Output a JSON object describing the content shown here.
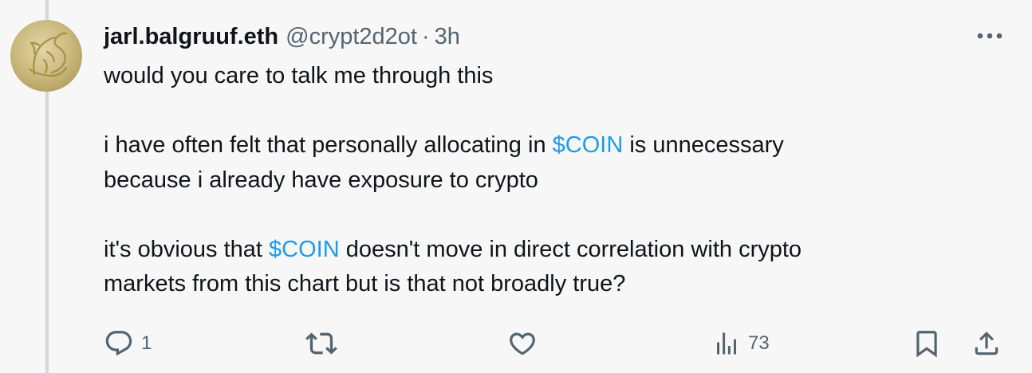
{
  "tweet": {
    "display_name": "jarl.balgruuf.eth",
    "handle": "@crypt2d2ot",
    "separator": "·",
    "time": "3h",
    "lines": {
      "l1": "would you care to talk me through this",
      "l2_a": "i have often felt that personally allocating in ",
      "cashtag": "$COIN",
      "l2_b": " is unnecessary",
      "l3": "because i already have exposure to crypto",
      "l4_a": "it's obvious that ",
      "l4_b": " doesn't move in direct correlation with crypto",
      "l5": "markets from this chart but is that not  broadly true?"
    }
  },
  "actions": {
    "reply_count": "1",
    "views_count": "73"
  },
  "icons": {
    "reply": "reply-icon",
    "retweet": "retweet-icon",
    "like": "heart-icon",
    "views": "views-icon",
    "bookmark": "bookmark-icon",
    "share": "share-icon",
    "more": "more-icon"
  },
  "colors": {
    "background": "#f7f7f7",
    "text": "#0f1419",
    "muted": "#536471",
    "link": "#1d9bf0",
    "thread_line": "#cfd9de"
  }
}
